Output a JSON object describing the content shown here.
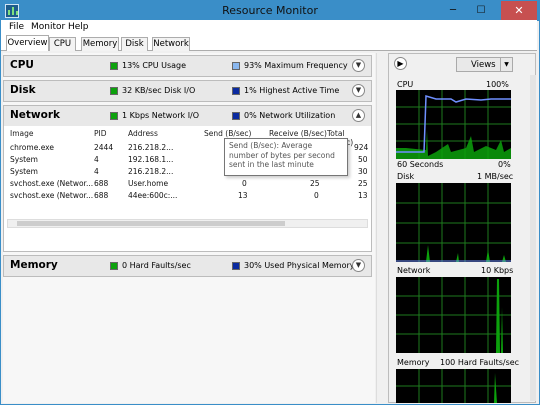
{
  "window": {
    "title": "Resource Monitor",
    "minimize_glyph": "─",
    "maximize_glyph": "☐",
    "close_glyph": "✕"
  },
  "menu": [
    "File",
    "Monitor",
    "Help"
  ],
  "tabs": [
    "Overview",
    "CPU",
    "Memory",
    "Disk",
    "Network"
  ],
  "active_tab": "Overview",
  "sections": {
    "cpu": {
      "title": "CPU",
      "stat1": "13% CPU Usage",
      "stat2": "93% Maximum Frequency",
      "expanded": false
    },
    "disk": {
      "title": "Disk",
      "stat1": "32 KB/sec Disk I/O",
      "stat2": "1% Highest Active Time",
      "expanded": false
    },
    "network": {
      "title": "Network",
      "stat1": "1 Kbps Network I/O",
      "stat2": "0% Network Utilization",
      "expanded": true
    },
    "memory": {
      "title": "Memory",
      "stat1": "0 Hard Faults/sec",
      "stat2": "30% Used Physical Memory",
      "expanded": false
    }
  },
  "chevrons": {
    "down": "▼",
    "up": "▲",
    "right": "▶"
  },
  "network_table": {
    "columns": [
      "Image",
      "PID",
      "Address",
      "Send (B/sec)",
      "Receive (B/sec)",
      "Total (B/sec)"
    ],
    "rows": [
      [
        "chrome.exe",
        "2444",
        "216.218.2...",
        "",
        "",
        "924"
      ],
      [
        "System",
        "4",
        "192.168.1...",
        "",
        "",
        "50"
      ],
      [
        "System",
        "4",
        "216.218.2...",
        "",
        "",
        "30"
      ],
      [
        "svchost.exe (Networ...",
        "688",
        "User.home",
        "0",
        "25",
        "25"
      ],
      [
        "svchost.exe (Networ...",
        "688",
        "44ee:600c:...",
        "13",
        "0",
        "13"
      ]
    ]
  },
  "tooltip": "Send (B/sec): Average number of bytes per second sent in the last minute",
  "views_button": "Views",
  "graphs": {
    "cpu": {
      "title": "CPU",
      "max": "100%",
      "time": "60 Seconds",
      "min": "0%"
    },
    "disk": {
      "title": "Disk",
      "max": "1 MB/sec"
    },
    "network": {
      "title": "Network",
      "max": "10 Kbps"
    },
    "memory": {
      "title": "Memory",
      "max": "100 Hard Faults/sec"
    }
  },
  "colors": {
    "titlebar": "#3a8ec8",
    "close": "#c75050",
    "cpu_usage": "#0ca10c",
    "frequency": "#6f8fff",
    "graph_bg": "#000000",
    "grid": "#1e7a1e"
  }
}
